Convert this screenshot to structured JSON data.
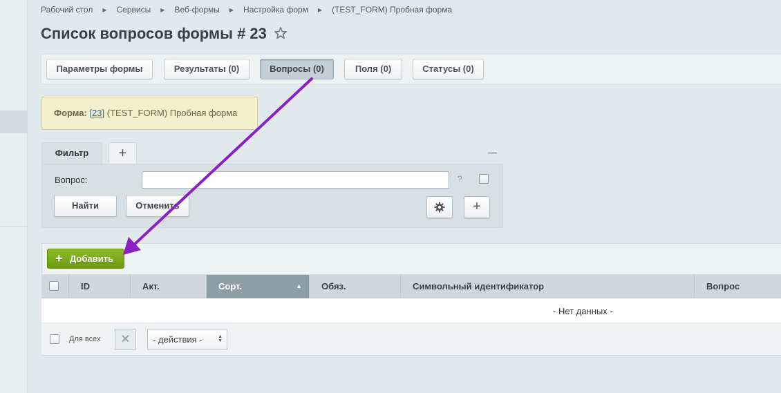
{
  "breadcrumb": [
    "Рабочий стол",
    "Сервисы",
    "Веб-формы",
    "Настройка форм",
    "(TEST_FORM) Пробная форма"
  ],
  "page": {
    "title": "Список вопросов формы # 23"
  },
  "tabs": [
    {
      "label": "Параметры формы",
      "active": false
    },
    {
      "label": "Результаты (0)",
      "active": false
    },
    {
      "label": "Вопросы (0)",
      "active": true
    },
    {
      "label": "Поля (0)",
      "active": false
    },
    {
      "label": "Статусы (0)",
      "active": false
    }
  ],
  "info": {
    "label": "Форма:",
    "id_link": "[23]",
    "name": " (TEST_FORM) Пробная форма"
  },
  "filter": {
    "tab_label": "Фильтр",
    "field_label": "Вопрос:",
    "field_value": "",
    "help": "?",
    "find_label": "Найти",
    "cancel_label": "Отменить"
  },
  "grid": {
    "add_label": "Добавить",
    "columns": [
      "ID",
      "Акт.",
      "Сорт.",
      "Обяз.",
      "Символьный идентификатор",
      "Вопрос"
    ],
    "sorted_column": "Сорт.",
    "empty_text": "- Нет данных -",
    "footer": {
      "for_all_label": "Для всех",
      "actions_select": "- действия -"
    }
  },
  "colors": {
    "accent_green": "#7aa81a",
    "annotation_arrow": "#8a1fc4",
    "info_bg": "#f3eecb"
  }
}
